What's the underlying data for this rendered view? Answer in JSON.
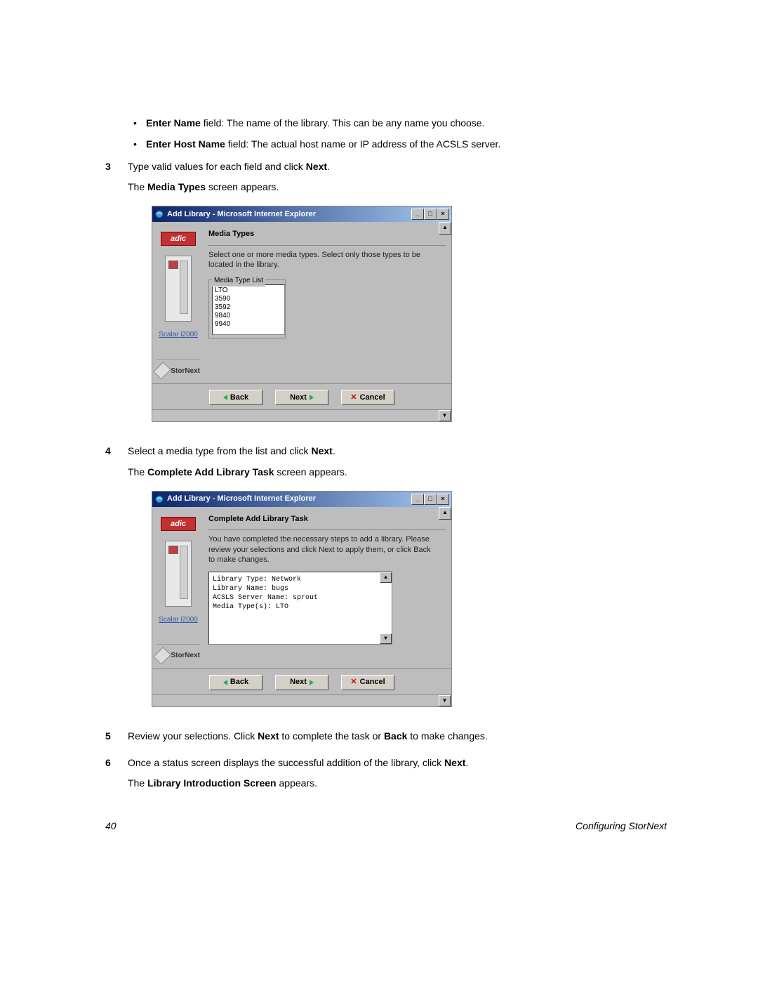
{
  "bullets": [
    {
      "bold": "Enter Name",
      "rest": " field: The name of the library. This can be any name you choose."
    },
    {
      "bold": "Enter Host Name",
      "rest": " field: The actual host name or IP address of the ACSLS server."
    }
  ],
  "steps": {
    "s3": {
      "num": "3",
      "line1_pre": "Type valid values for each field and click ",
      "line1_bold": "Next",
      "line1_post": ".",
      "line2_pre": "The ",
      "line2_bold": "Media Types",
      "line2_post": " screen appears."
    },
    "s4": {
      "num": "4",
      "line1_pre": "Select a media type from the list and click ",
      "line1_bold": "Next",
      "line1_post": ".",
      "line2_pre": "The ",
      "line2_bold": "Complete Add Library Task",
      "line2_post": " screen appears."
    },
    "s5": {
      "num": "5",
      "pre": "Review your selections. Click ",
      "b1": "Next",
      "mid": " to complete the task or ",
      "b2": "Back",
      "post": " to make changes."
    },
    "s6": {
      "num": "6",
      "line1_pre": "Once a status screen displays the successful addition of the library, click ",
      "line1_bold": "Next",
      "line1_post": ".",
      "line2_pre": "The ",
      "line2_bold": "Library Introduction Screen",
      "line2_post": " appears."
    }
  },
  "dialog1": {
    "title": "Add Library - Microsoft Internet Explorer",
    "logo": "adic",
    "scalar": "Scalar i2000",
    "stornext": "StorNext",
    "heading": "Media Types",
    "instruction": "Select one or more media types. Select only those types to be located in the library.",
    "fieldset_legend": "Media Type List",
    "options": [
      "LTO",
      "3590",
      "3592",
      "9840",
      "9940"
    ],
    "buttons": {
      "back": "Back",
      "next": "Next",
      "cancel": "Cancel"
    }
  },
  "dialog2": {
    "title": "Add Library - Microsoft Internet Explorer",
    "logo": "adic",
    "scalar": "Scalar i2000",
    "stornext": "StorNext",
    "heading": "Complete Add Library Task",
    "instruction": "You have completed the necessary steps to add a library. Please review your selections and click Next to apply them, or click Back to make changes.",
    "review": [
      "Library Type: Network",
      "Library Name: bugs",
      "ACSLS Server Name: sprout",
      "Media Type(s): LTO"
    ],
    "buttons": {
      "back": "Back",
      "next": "Next",
      "cancel": "Cancel"
    }
  },
  "footer": {
    "page": "40",
    "section": "Configuring StorNext"
  }
}
